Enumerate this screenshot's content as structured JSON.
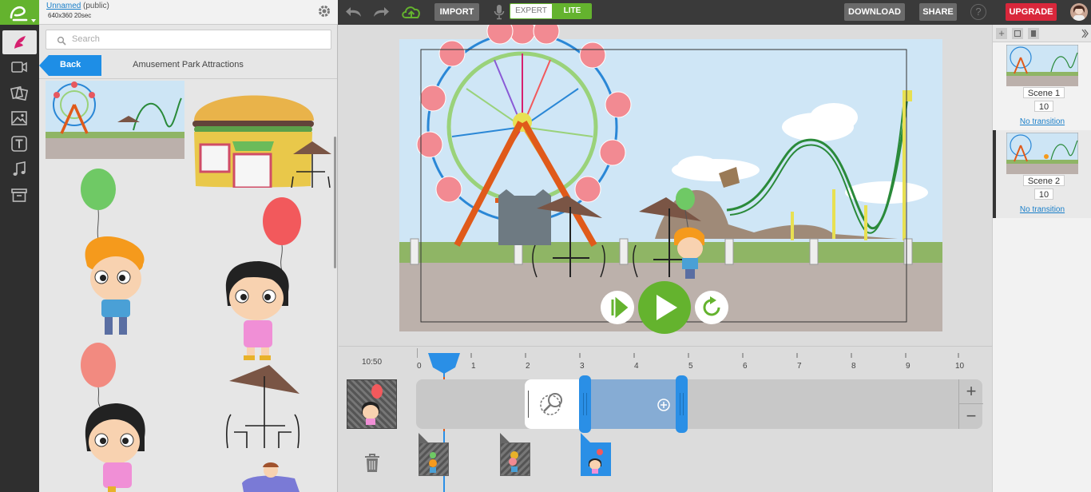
{
  "project": {
    "name": "Unnamed",
    "visibility": "(public)",
    "meta": "640x360  20sec"
  },
  "toolbar": {
    "import_label": "IMPORT",
    "expert_label": "EXPERT",
    "lite_label": "LITE",
    "download_label": "DOWNLOAD",
    "share_label": "SHARE",
    "help_label": "?",
    "upgrade_label": "UPGRADE"
  },
  "library": {
    "search_placeholder": "Search",
    "back_label": "Back",
    "title": "Amusement Park Attractions"
  },
  "timeline": {
    "time_label": "10:50",
    "ticks": [
      "0",
      "1",
      "2",
      "3",
      "4",
      "5",
      "6",
      "7",
      "8",
      "9",
      "10"
    ],
    "zoom_in": "+",
    "zoom_out": "−"
  },
  "scenes": [
    {
      "label": "Scene 1",
      "duration": "10",
      "transition": "No transition"
    },
    {
      "label": "Scene 2",
      "duration": "10",
      "transition": "No transition"
    }
  ],
  "colors": {
    "brand": "#64b32e",
    "upgrade": "#d9273b",
    "link": "#1a7fc9",
    "selection": "#2a8fe6"
  }
}
